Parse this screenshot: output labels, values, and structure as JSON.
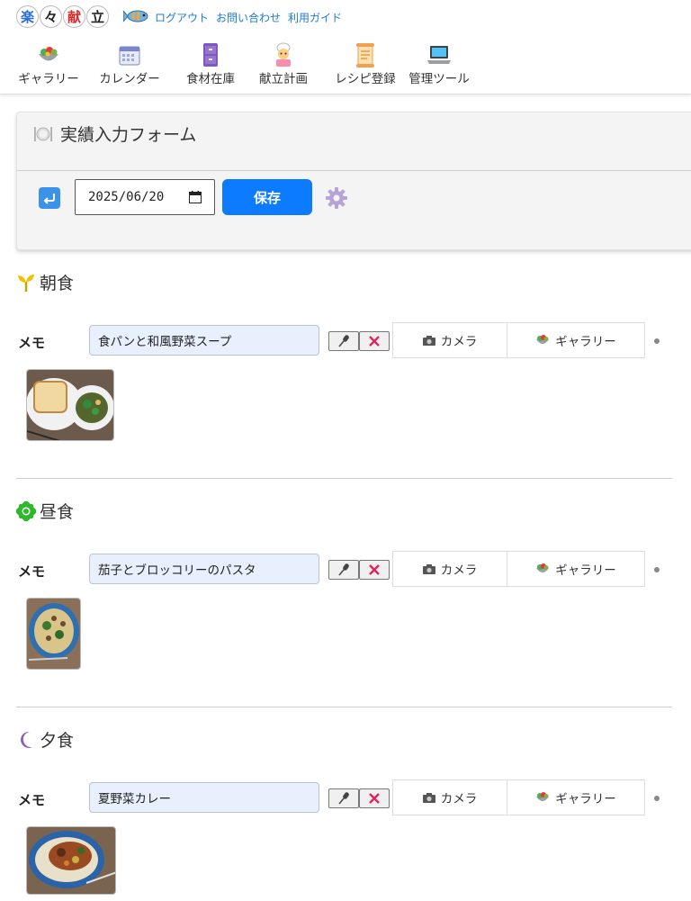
{
  "header": {
    "logo": [
      "楽",
      "々",
      "献",
      "立"
    ],
    "links": [
      "ログアウト",
      "お問い合わせ",
      "利用ガイド"
    ],
    "nav": [
      {
        "label": "ギャラリー",
        "icon": "salad-bowl-icon"
      },
      {
        "label": "カレンダー",
        "icon": "calendar-icon"
      },
      {
        "label": "食材在庫",
        "icon": "cabinet-icon"
      },
      {
        "label": "献立計画",
        "icon": "chef-icon"
      },
      {
        "label": "レシピ登録",
        "icon": "scroll-icon"
      },
      {
        "label": "管理ツール",
        "icon": "laptop-icon"
      }
    ]
  },
  "form": {
    "title": "実績入力フォーム",
    "date": "2025/06/20",
    "save_label": "保存"
  },
  "meals": [
    {
      "title": "朝食",
      "icon": "sprout-icon",
      "memo_label": "メモ",
      "memo": "食パンと和風野菜スープ",
      "camera_label": "カメラ",
      "gallery_label": "ギャラリー"
    },
    {
      "title": "昼食",
      "icon": "sun-icon",
      "memo_label": "メモ",
      "memo": "茄子とブロッコリーのパスタ",
      "camera_label": "カメラ",
      "gallery_label": "ギャラリー"
    },
    {
      "title": "夕食",
      "icon": "moon-icon",
      "memo_label": "メモ",
      "memo": "夏野菜カレー",
      "camera_label": "カメラ",
      "gallery_label": "ギャラリー"
    }
  ],
  "colors": {
    "link": "#1e7bd6",
    "save": "#0d7bff",
    "memo_bg": "#e8f0fe",
    "delete": "#e0245e"
  }
}
